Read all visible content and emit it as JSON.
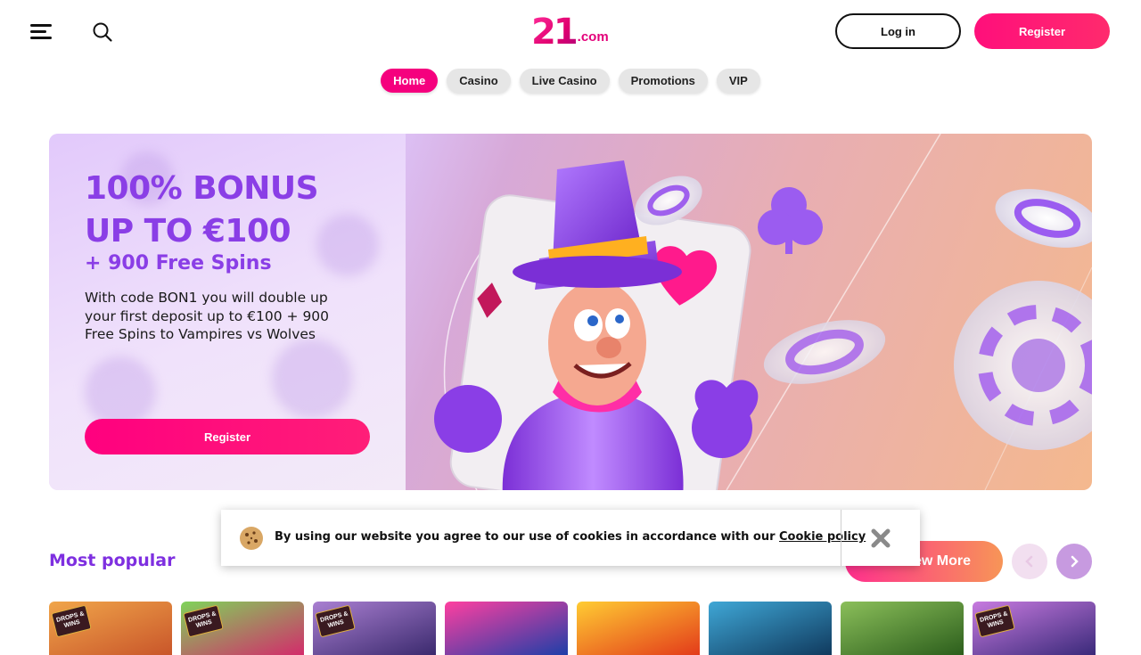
{
  "header": {
    "logo_mark": "21",
    "logo_tld": ".com",
    "login_label": "Log in",
    "register_label": "Register"
  },
  "nav": {
    "tabs": [
      {
        "label": "Home",
        "active": true
      },
      {
        "label": "Casino",
        "active": false
      },
      {
        "label": "Live Casino",
        "active": false
      },
      {
        "label": "Promotions",
        "active": false
      },
      {
        "label": "VIP",
        "active": false
      }
    ]
  },
  "hero": {
    "title_line1": "100% BONUS",
    "title_line2": "UP TO €100",
    "subtitle": "+ 900 Free Spins",
    "description": "With code BON1 you will double up your first deposit up to €100 + 900 Free Spins to Vampires vs Wolves",
    "register_label": "Register"
  },
  "popular": {
    "title": "Most popular",
    "view_more_label": "View More",
    "games": [
      {
        "badge": "DROPS & WINS",
        "colors": [
          "#c9562a",
          "#f0a54a"
        ]
      },
      {
        "badge": "DROPS & WINS",
        "colors": [
          "#d32b6b",
          "#7fd35a"
        ]
      },
      {
        "badge": "DROPS & WINS",
        "colors": [
          "#3b2a6e",
          "#a97fd1"
        ]
      },
      {
        "badge": "",
        "colors": [
          "#1e3fa8",
          "#ff3fa0"
        ]
      },
      {
        "badge": "",
        "colors": [
          "#e33b1a",
          "#ffcc33"
        ]
      },
      {
        "badge": "",
        "colors": [
          "#103a5e",
          "#3fa7d6"
        ]
      },
      {
        "badge": "",
        "colors": [
          "#2c5e1c",
          "#8bbf5a"
        ]
      },
      {
        "badge": "DROPS & WINS",
        "colors": [
          "#3a2a7a",
          "#c77adf"
        ]
      }
    ]
  },
  "cookie": {
    "text": "By using our website you agree to our use of cookies in accordance with our ",
    "link_label": "Cookie policy"
  },
  "colors": {
    "brand_pink": "#f5007e",
    "brand_purple": "#8a3ee6"
  }
}
